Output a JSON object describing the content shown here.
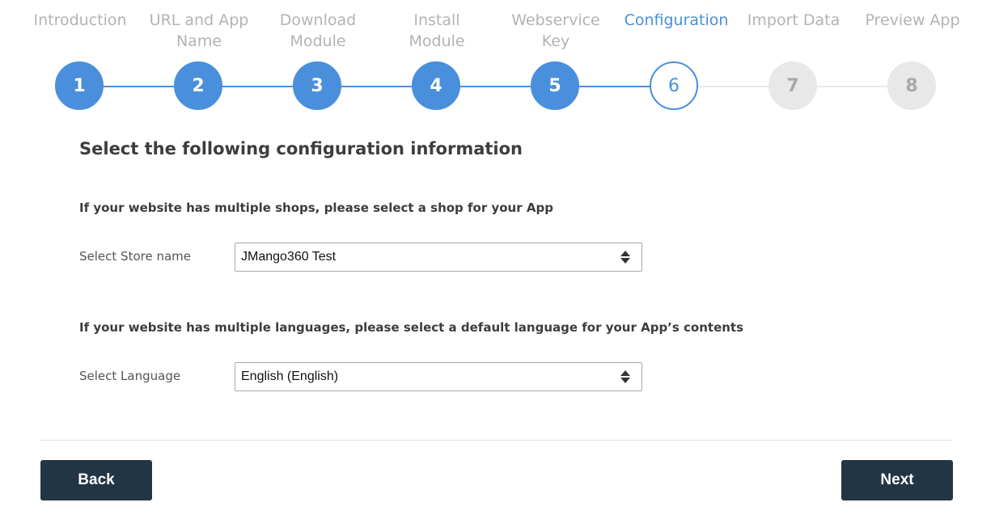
{
  "stepper": {
    "steps": [
      {
        "number": "1",
        "label": "Introduction",
        "state": "done"
      },
      {
        "number": "2",
        "label": "URL and App\nName",
        "state": "done"
      },
      {
        "number": "3",
        "label": "Download\nModule",
        "state": "done"
      },
      {
        "number": "4",
        "label": "Install\nModule",
        "state": "done"
      },
      {
        "number": "5",
        "label": "Webservice\nKey",
        "state": "done"
      },
      {
        "number": "6",
        "label": "Configuration",
        "state": "current"
      },
      {
        "number": "7",
        "label": "Import Data",
        "state": "todo"
      },
      {
        "number": "8",
        "label": "Preview App",
        "state": "todo"
      }
    ]
  },
  "main": {
    "heading": "Select the following configuration information",
    "store_prompt": "If your website has multiple shops, please select a shop for your App",
    "store_label": "Select Store name",
    "store_value": "JMango360 Test",
    "language_prompt": "If your website has multiple languages, please select a default language for your App’s contents",
    "language_label": "Select Language",
    "language_value": "English (English)"
  },
  "footer": {
    "back_label": "Back",
    "next_label": "Next"
  },
  "colors": {
    "accent": "#4a8fdc",
    "inactive": "#e8e8e8",
    "button": "#223544"
  }
}
